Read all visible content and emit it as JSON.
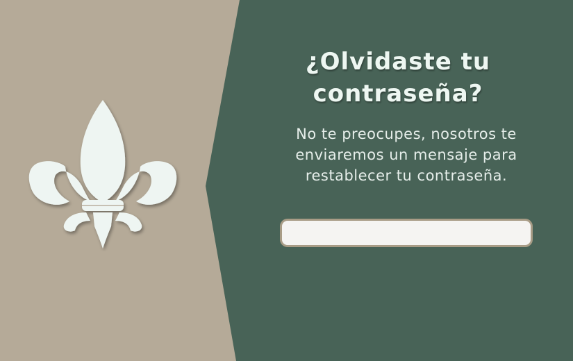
{
  "theme": {
    "left_background": "#b5aa98",
    "right_background": "#486357",
    "heading_color": "#eef7f2",
    "input_border": "#a89c86",
    "input_background": "#f5f4f2"
  },
  "branding": {
    "logo_icon": "fleur-de-lis-icon"
  },
  "recovery": {
    "title_line1": "¿Olvidaste tu",
    "title_line2": "contraseña?",
    "message_line1": "No te preocupes, nosotros te",
    "message_line2": "enviaremos un mensaje para",
    "message_line3": "restablecer tu contraseña.",
    "email_value": "",
    "email_placeholder": ""
  }
}
